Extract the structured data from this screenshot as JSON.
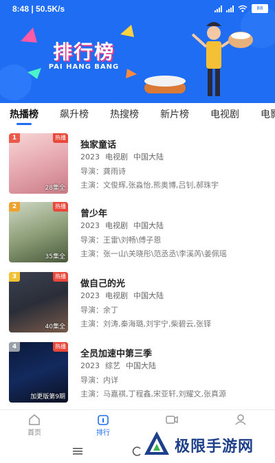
{
  "status_bar": {
    "time": "8:48 | 50.5K/s",
    "battery": "88"
  },
  "banner": {
    "title": "排行榜",
    "subtitle": "PAI HANG BANG"
  },
  "tabs": [
    "热播榜",
    "飙升榜",
    "热搜榜",
    "新片榜",
    "电视剧",
    "电影"
  ],
  "list": [
    {
      "rank": "1",
      "badge": "热播",
      "episodes": "28集全",
      "title": "独家童话",
      "year": "2023",
      "type": "电视剧",
      "region": "中国大陆",
      "director": "导演：龚雨诗",
      "cast": "主演：文俊辉,张淼怡,熊奥博,吕钊,郝珠宇"
    },
    {
      "rank": "2",
      "badge": "热播",
      "episodes": "35集全",
      "title": "曾少年",
      "year": "2023",
      "type": "电视剧",
      "region": "中国大陆",
      "director": "导演：王雷\\刘畅\\傅子恩",
      "cast": "主演：张一山\\关晓彤\\范丞丞\\李溪芮\\姜佩瑶"
    },
    {
      "rank": "3",
      "badge": "热播",
      "episodes": "40集全",
      "title": "做自己的光",
      "year": "2023",
      "type": "电视剧",
      "region": "中国大陆",
      "director": "导演：余丁",
      "cast": "主演：刘涛,秦海璐,刘宇宁,柴碧云,张铎"
    },
    {
      "rank": "4",
      "badge": "热播",
      "episodes": "加更版第9期",
      "title": "全员加速中第三季",
      "year": "2023",
      "type": "综艺",
      "region": "中国大陆",
      "director": "导演：内详",
      "cast": "主演：马嘉祺,丁程鑫,宋亚轩,刘耀文,张真源"
    }
  ],
  "bottom_nav": [
    {
      "label": "首页",
      "icon": "home-icon"
    },
    {
      "label": "排行",
      "icon": "ranking-icon"
    },
    {
      "label": "",
      "icon": "video-icon"
    },
    {
      "label": "",
      "icon": "user-icon"
    }
  ],
  "watermark": {
    "text": "极限手游网"
  },
  "colors": {
    "accent": "#1e6df2",
    "hot_badge": "#e8473a",
    "rank_1": "#ec5b4a",
    "rank_2": "#f0a22f",
    "rank_3": "#f2c233"
  }
}
